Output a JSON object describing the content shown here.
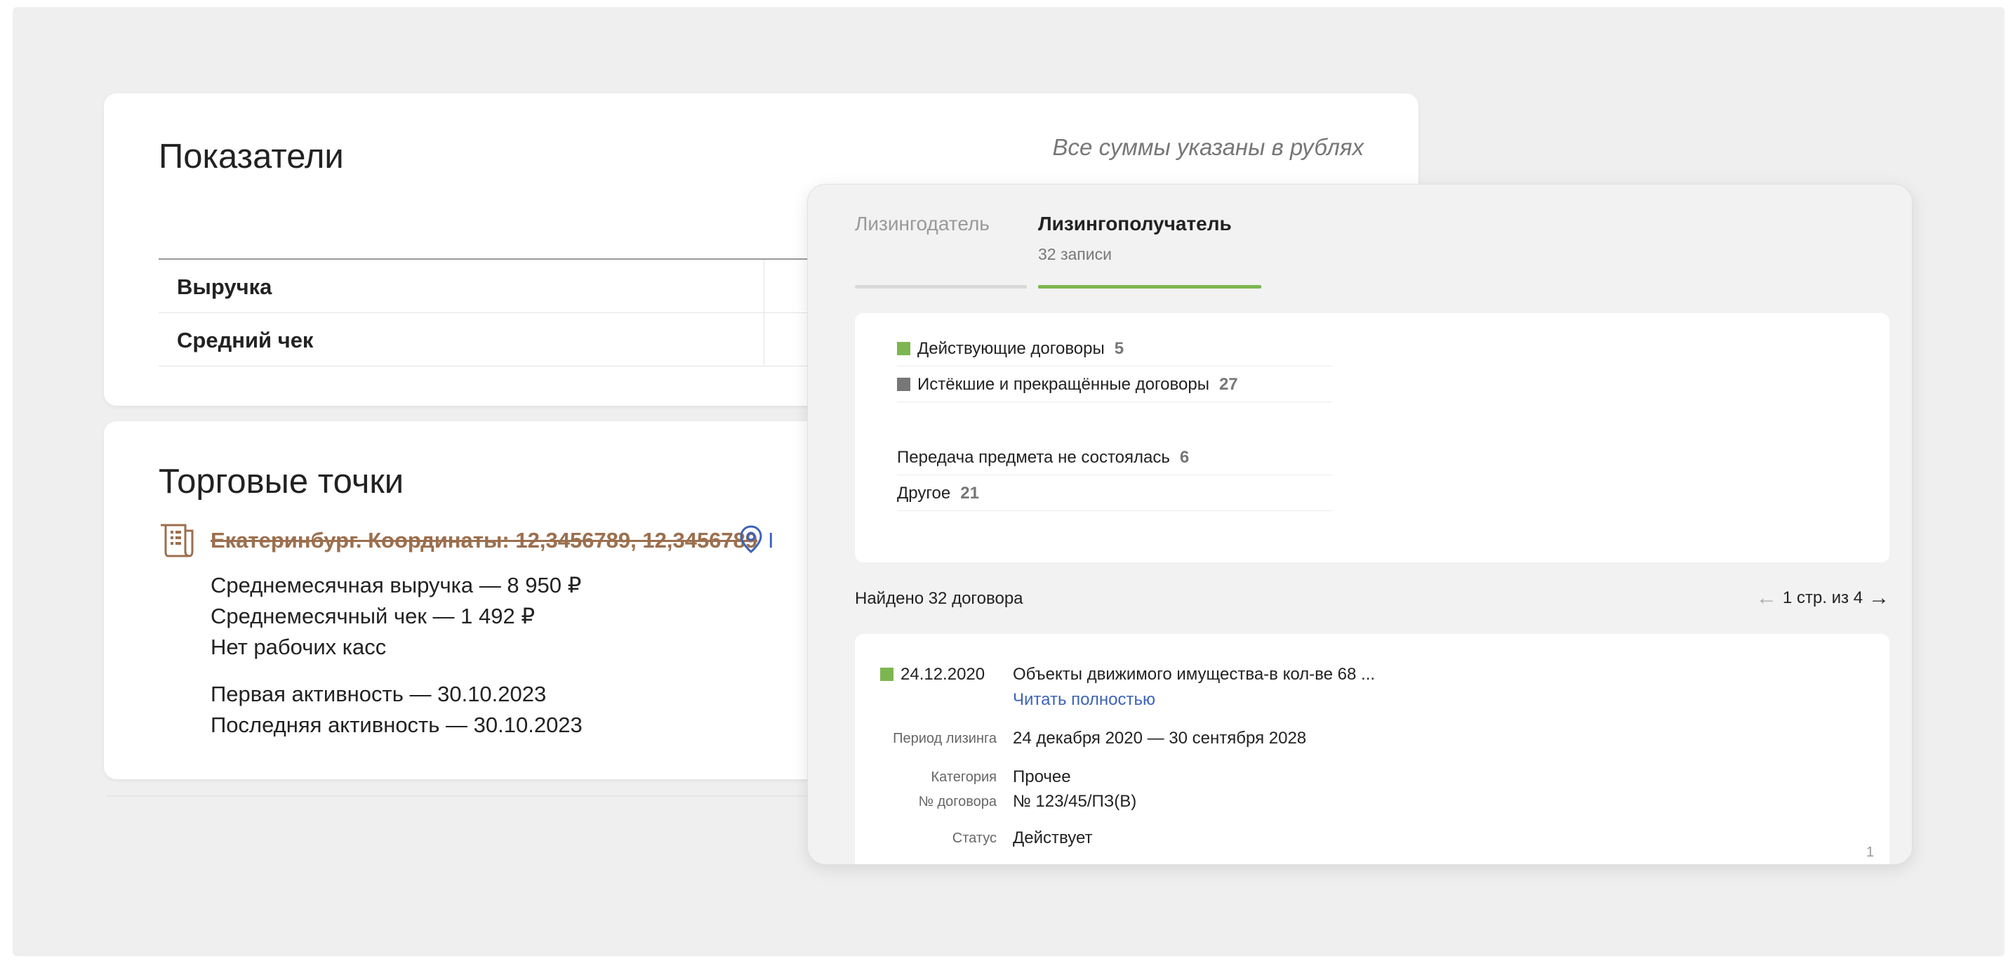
{
  "indicators": {
    "title": "Показатели",
    "note": "Все суммы указаны в рублях",
    "rows": [
      {
        "label": "Выручка"
      },
      {
        "label": "Средний чек"
      }
    ]
  },
  "outlets": {
    "title": "Торговые точки",
    "address": "Екатеринбург. Координаты: 12,3456789, 12,3456789",
    "map_link_fragment": "I",
    "stats": [
      "Среднемесячная выручка — 8 950 ₽",
      "Среднемесячный чек — 1 492 ₽",
      "Нет рабочих касс"
    ],
    "activity": [
      "Первая активность — 30.10.2023",
      "Последняя активность — 30.10.2023"
    ]
  },
  "panel": {
    "tabs": [
      {
        "label": "Лизингодатель",
        "sub": ""
      },
      {
        "label": "Лизингополучатель",
        "sub": "32 записи"
      }
    ],
    "summary": {
      "active": {
        "label": "Действующие договоры",
        "count": "5",
        "color": "#7db651"
      },
      "expired": {
        "label": "Истёкшие и прекращённые договоры",
        "count": "27",
        "color": "#777777"
      },
      "failed": {
        "label": "Передача предмета не состоялась",
        "count": "6"
      },
      "other": {
        "label": "Другое",
        "count": "21"
      }
    },
    "found": "Найдено 32 договора",
    "pager": {
      "text": "1 стр. из 4",
      "prev_icon": "arrow-left-icon",
      "next_icon": "arrow-right-icon"
    },
    "contract": {
      "date": "24.12.2020",
      "title": "Объекты движимого имущества-в кол-ве 68 ...",
      "read_more": "Читать полностью",
      "period_label": "Период лизинга",
      "period_value": "24 декабря 2020 — 30 сентября 2028",
      "category_label": "Категория",
      "category_value": "Прочее",
      "number_label": "№ договора",
      "number_value": "№ 123/45/ПЗ(В)",
      "status_label": "Статус",
      "status_value": "Действует",
      "index": "1"
    }
  },
  "colors": {
    "accent_green": "#7db651",
    "link_blue": "#3d63b8",
    "address_brown": "#9b6f4e"
  }
}
